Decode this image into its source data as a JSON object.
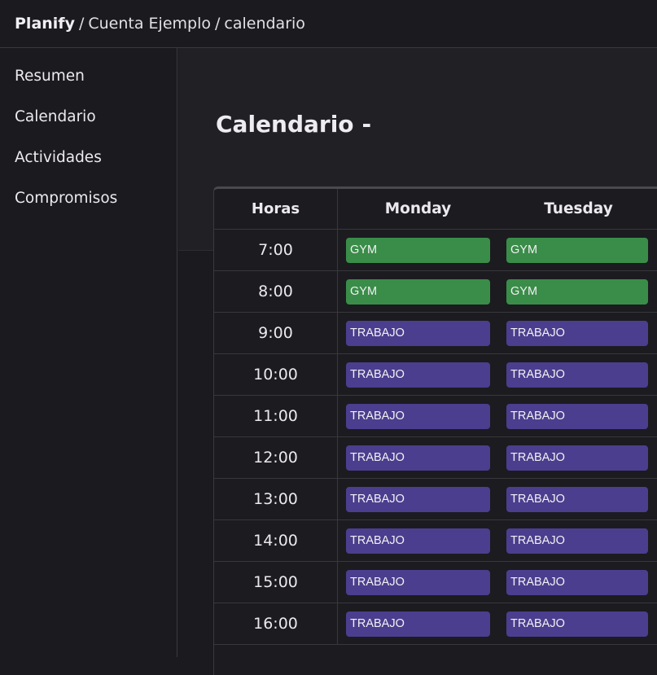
{
  "breadcrumb": {
    "brand": "Planify",
    "separator": "/",
    "account": "Cuenta Ejemplo",
    "page": "calendario"
  },
  "sidebar": {
    "items": [
      {
        "label": "Resumen"
      },
      {
        "label": "Calendario"
      },
      {
        "label": "Actividades"
      },
      {
        "label": "Compromisos"
      }
    ]
  },
  "page": {
    "title": "Calendario",
    "title_suffix": "-"
  },
  "calendar": {
    "headers": {
      "hours": "Horas",
      "day1": "Monday",
      "day2": "Tuesday"
    },
    "rows": [
      {
        "hour": "7:00",
        "day1": "GYM",
        "day2": "GYM",
        "type": "gym"
      },
      {
        "hour": "8:00",
        "day1": "GYM",
        "day2": "GYM",
        "type": "gym"
      },
      {
        "hour": "9:00",
        "day1": "TRABAJO",
        "day2": "TRABAJO",
        "type": "work"
      },
      {
        "hour": "10:00",
        "day1": "TRABAJO",
        "day2": "TRABAJO",
        "type": "work"
      },
      {
        "hour": "11:00",
        "day1": "TRABAJO",
        "day2": "TRABAJO",
        "type": "work"
      },
      {
        "hour": "12:00",
        "day1": "TRABAJO",
        "day2": "TRABAJO",
        "type": "work"
      },
      {
        "hour": "13:00",
        "day1": "TRABAJO",
        "day2": "TRABAJO",
        "type": "work"
      },
      {
        "hour": "14:00",
        "day1": "TRABAJO",
        "day2": "TRABAJO",
        "type": "work"
      },
      {
        "hour": "15:00",
        "day1": "TRABAJO",
        "day2": "TRABAJO",
        "type": "work"
      },
      {
        "hour": "16:00",
        "day1": "TRABAJO",
        "day2": "TRABAJO",
        "type": "work"
      }
    ]
  },
  "colors": {
    "background": "#1b1a1e",
    "gym": "#3a8d48",
    "work": "#4b3e8e"
  }
}
